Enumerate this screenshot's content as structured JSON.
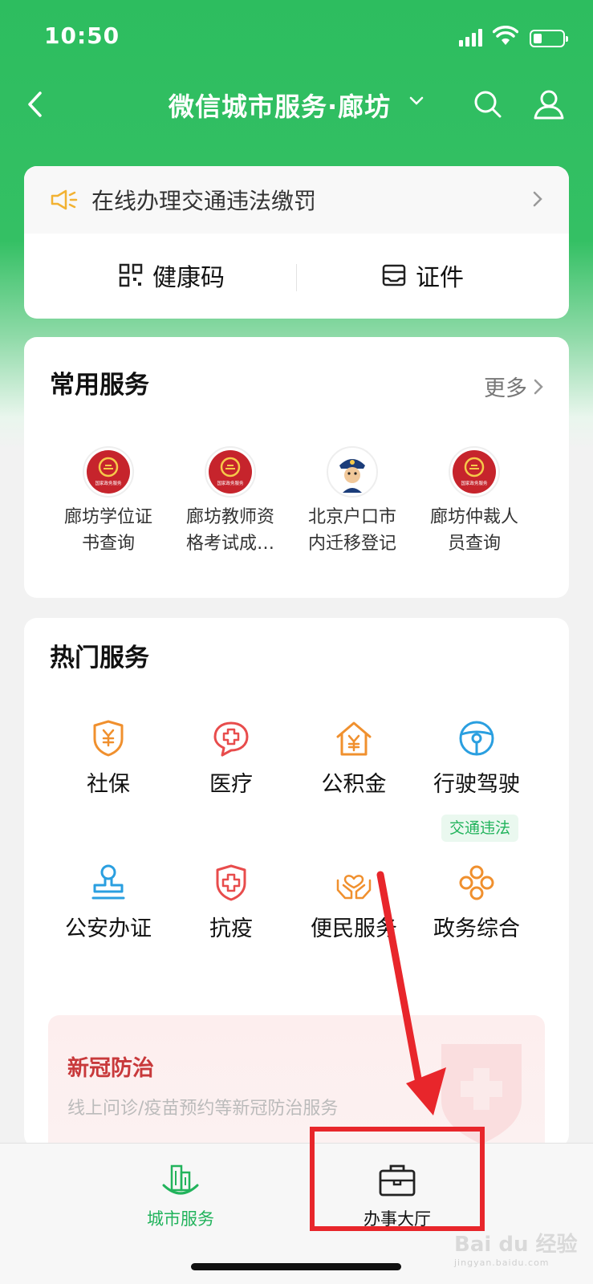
{
  "status_bar": {
    "time": "10:50"
  },
  "nav": {
    "title": "微信城市服务·廊坊"
  },
  "notice": {
    "text": "在线办理交通违法缴罚"
  },
  "quick_actions": [
    {
      "label": "健康码",
      "icon": "qrcode-icon"
    },
    {
      "label": "证件",
      "icon": "card-icon"
    }
  ],
  "common_services": {
    "title": "常用服务",
    "more": "更多",
    "items": [
      {
        "label_line1": "廊坊学位证",
        "label_line2": "书查询",
        "icon": "national-emblem-icon"
      },
      {
        "label_line1": "廊坊教师资",
        "label_line2": "格考试成…",
        "icon": "national-emblem-icon"
      },
      {
        "label_line1": "北京户口市",
        "label_line2": "内迁移登记",
        "icon": "police-mascot-icon"
      },
      {
        "label_line1": "廊坊仲裁人",
        "label_line2": "员查询",
        "icon": "national-emblem-icon"
      }
    ],
    "emblem_text": "国家政务服务"
  },
  "hot_services": {
    "title": "热门服务",
    "items": [
      {
        "label": "社保",
        "icon": "shield-yen-icon",
        "color": "#f0902e"
      },
      {
        "label": "医疗",
        "icon": "medical-cross-icon",
        "color": "#e84c4c"
      },
      {
        "label": "公积金",
        "icon": "house-yen-icon",
        "color": "#f0902e"
      },
      {
        "label": "行驶驾驶",
        "icon": "steering-wheel-icon",
        "color": "#2a9fe0"
      },
      {
        "label": "公安办证",
        "icon": "stamp-icon",
        "color": "#2a9fe0"
      },
      {
        "label": "抗疫",
        "icon": "shield-cross-icon",
        "color": "#e84c4c"
      },
      {
        "label": "便民服务",
        "icon": "hands-heart-icon",
        "color": "#f0902e"
      },
      {
        "label": "政务综合",
        "icon": "clover-icon",
        "color": "#f0902e"
      }
    ],
    "tag": "交通违法"
  },
  "banner": {
    "title": "新冠防治",
    "subtitle": "线上问诊/疫苗预约等新冠防治服务"
  },
  "tabbar": {
    "items": [
      {
        "label": "城市服务",
        "icon": "city-buildings-icon",
        "active": true
      },
      {
        "label": "办事大厅",
        "icon": "briefcase-icon",
        "active": false
      }
    ]
  },
  "watermark": {
    "brand": "Bai du 经验",
    "url": "jingyan.baidu.com"
  },
  "colors": {
    "brand_green": "#2dbd5f",
    "active_tab": "#22b35c",
    "annotation_red": "#e8262b"
  }
}
